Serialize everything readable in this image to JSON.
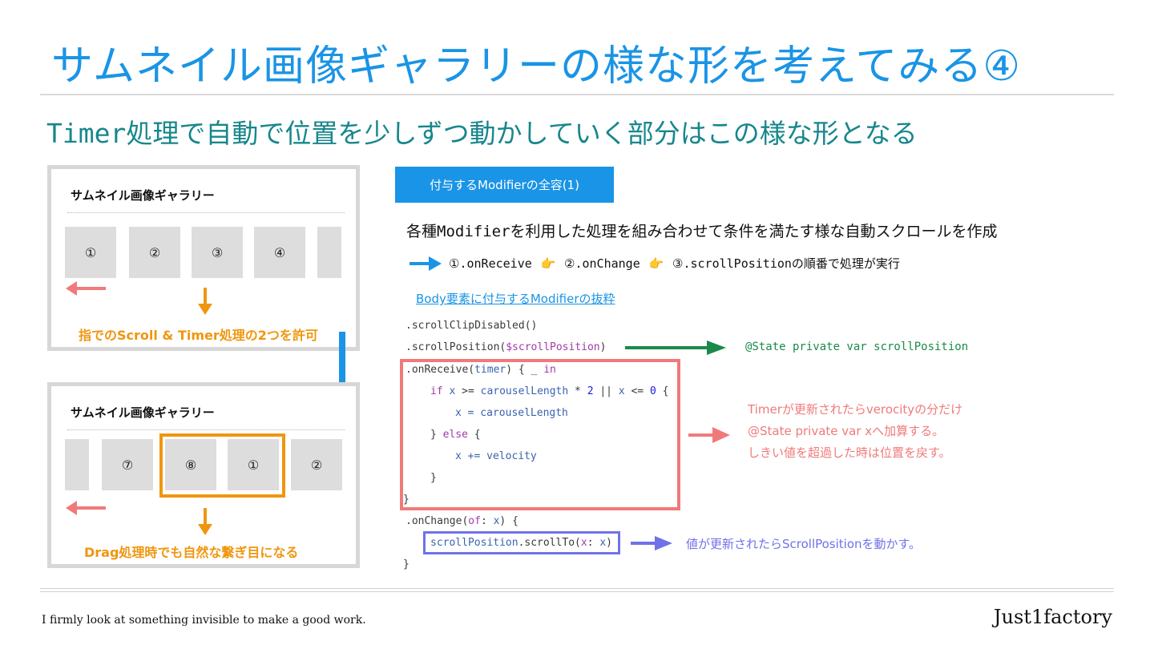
{
  "title": "サムネイル画像ギャラリーの様な形を考えてみる④",
  "subtitle": {
    "prefix": "Timer",
    "rest": "処理で自動で位置を少しずつ動かしていく部分はこの様な形となる"
  },
  "panel1": {
    "title": "サムネイル画像ギャラリー",
    "thumbs": [
      "①",
      "②",
      "③",
      "④"
    ],
    "caption": "指でのScroll & Timer処理の2つを許可"
  },
  "panel2": {
    "title": "サムネイル画像ギャラリー",
    "thumbs": [
      "⑦",
      "⑧",
      "①",
      "②"
    ],
    "caption": "Drag処理時でも自然な繋ぎ目になる"
  },
  "modifier_button": "付与するModifierの全容(1)",
  "description": {
    "prefix": "各種",
    "mono": "Modifier",
    "rest": "を利用した処理を組み合わせて条件を満たす様な自動スクロールを作成"
  },
  "order": {
    "step1": "①.onReceive",
    "step2": "②.onChange",
    "step3": "③.scrollPositionの順番で処理が実行",
    "hand": "👉"
  },
  "body_link": "Body要素に付与するModifierの抜粋",
  "code": {
    "line1": ".scrollClipDisabled()",
    "line2a": ".scrollPosition(",
    "line2b": "$scrollPosition",
    "line2c": ")",
    "line3a": ".onReceive(",
    "line3b": "timer",
    "line3c": ") { _ ",
    "line3d": "in",
    "line4_if": "if",
    "line4_x": "x",
    "line4_ge": " >= ",
    "line4_len": "carouselLength",
    "line4_mul": " * ",
    "line4_two": "2",
    "line4_or": " || ",
    "line4_x2": "x",
    "line4_le": " <= ",
    "line4_zero": "0",
    "line4_end": " {",
    "line5": "x = carouselLength",
    "line6a": "} ",
    "line6b": "else",
    "line6c": " {",
    "line7": "x += velocity",
    "line8": "}",
    "line9": "}",
    "line10a": ".onChange(",
    "line10b": "of",
    "line10c": ": ",
    "line10d": "x",
    "line10e": ") {",
    "line11a": "scrollPosition",
    "line11b": ".scrollTo(",
    "line11c": "x",
    "line11d": ": ",
    "line11e": "x",
    "line11f": ")",
    "line12": "}"
  },
  "notes": {
    "state": "@State private var scrollPosition",
    "timer_1": "Timerが更新されたらverocityの分だけ",
    "timer_2": "@State private var xへ加算する。",
    "timer_3": "しきい値を超過した時は位置を戻す。",
    "value": "値が更新されたらScrollPositionを動かす。"
  },
  "footer": {
    "tagline": "I firmly look at something invisible to make a good work.",
    "brand": "Just1factory"
  },
  "colors": {
    "title": "#1a94e6",
    "subtitle": "#17878c",
    "orange": "#f0960e",
    "pink": "#f07a7a",
    "green": "#1a8a4a",
    "purple": "#6f72e8",
    "blue_arrow": "#1a94e6"
  }
}
